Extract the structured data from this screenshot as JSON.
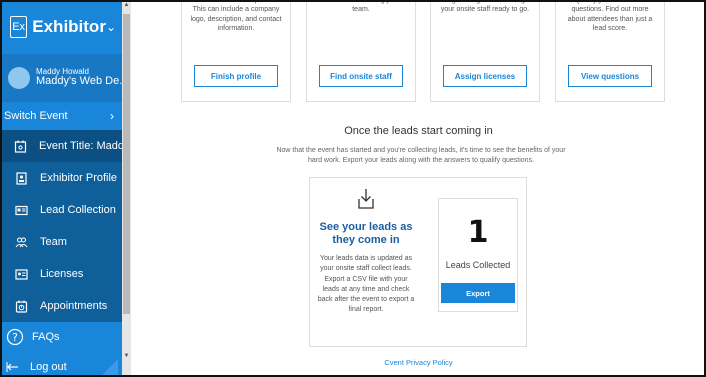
{
  "sidebar": {
    "brand_logo": "Ex",
    "brand_name": "Exhibitor",
    "user_name": "Maddy Howald",
    "user_event": "Maddy's Web De...",
    "switch_event": "Switch Event",
    "items": [
      {
        "label": "Event Title: Madd...",
        "icon": "event-icon"
      },
      {
        "label": "Exhibitor Profile",
        "icon": "profile-icon"
      },
      {
        "label": "Lead Collection",
        "icon": "lead-collection-icon"
      },
      {
        "label": "Team",
        "icon": "team-icon"
      },
      {
        "label": "Licenses",
        "icon": "licenses-icon"
      },
      {
        "label": "Appointments",
        "icon": "appointments-icon"
      }
    ],
    "faq": "FAQs",
    "logout": "Log out"
  },
  "cards": [
    {
      "text": "share with the event partners. This can include a company logo, description, and contact information.",
      "button": "Finish profile"
    },
    {
      "text": "staff. Finish creating your team.",
      "button": "Find onsite staff"
    },
    {
      "text": "assign. Assign licenses to get your onsite staff ready to go.",
      "button": "Assign licenses"
    },
    {
      "text": "Qualify your leads with questions. Find out more about attendees than just a lead score.",
      "button": "View questions"
    }
  ],
  "section": {
    "title": "Once the leads start coming in",
    "subtitle": "Now that the event has started and you're collecting leads, it's time to see the benefits of your hard work. Export your leads along with the answers to qualify questions."
  },
  "panel": {
    "heading": "See your leads as they come in",
    "body": "Your leads data is updated as your onsite staff collect leads. Export a CSV file with your leads at any time and check back after the event to export a final report.",
    "count": "1",
    "count_label": "Leads Collected",
    "export": "Export"
  },
  "footer": {
    "privacy": "Cvent Privacy Policy"
  },
  "colors": {
    "accent": "#1a86d9",
    "sidebar_dark": "#0f5f9b"
  }
}
